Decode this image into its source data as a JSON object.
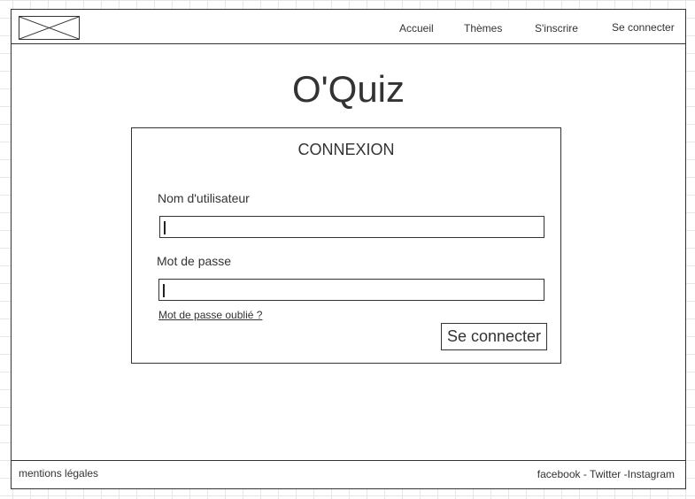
{
  "header": {
    "logo_icon": "image-placeholder-icon",
    "nav": {
      "home": "Accueil",
      "themes": "Thèmes",
      "signup": "S'inscrire",
      "login": "Se connecter"
    }
  },
  "main": {
    "title": "O'Quiz",
    "login_card": {
      "title": "CONNEXION",
      "username_label": "Nom d'utilisateur",
      "username_value": "",
      "password_label": "Mot de passe",
      "password_value": "",
      "forgot_link": "Mot de passe oublié ?",
      "submit_label": "Se connecter"
    }
  },
  "footer": {
    "legal": "mentions légales",
    "social": {
      "facebook": "facebook",
      "sep1": " - ",
      "twitter": "Twitter",
      "sep2": " -",
      "instagram": "Instagram"
    }
  },
  "colors": {
    "border": "#333333",
    "grid": "#e6e6e6",
    "background": "#ffffff"
  }
}
